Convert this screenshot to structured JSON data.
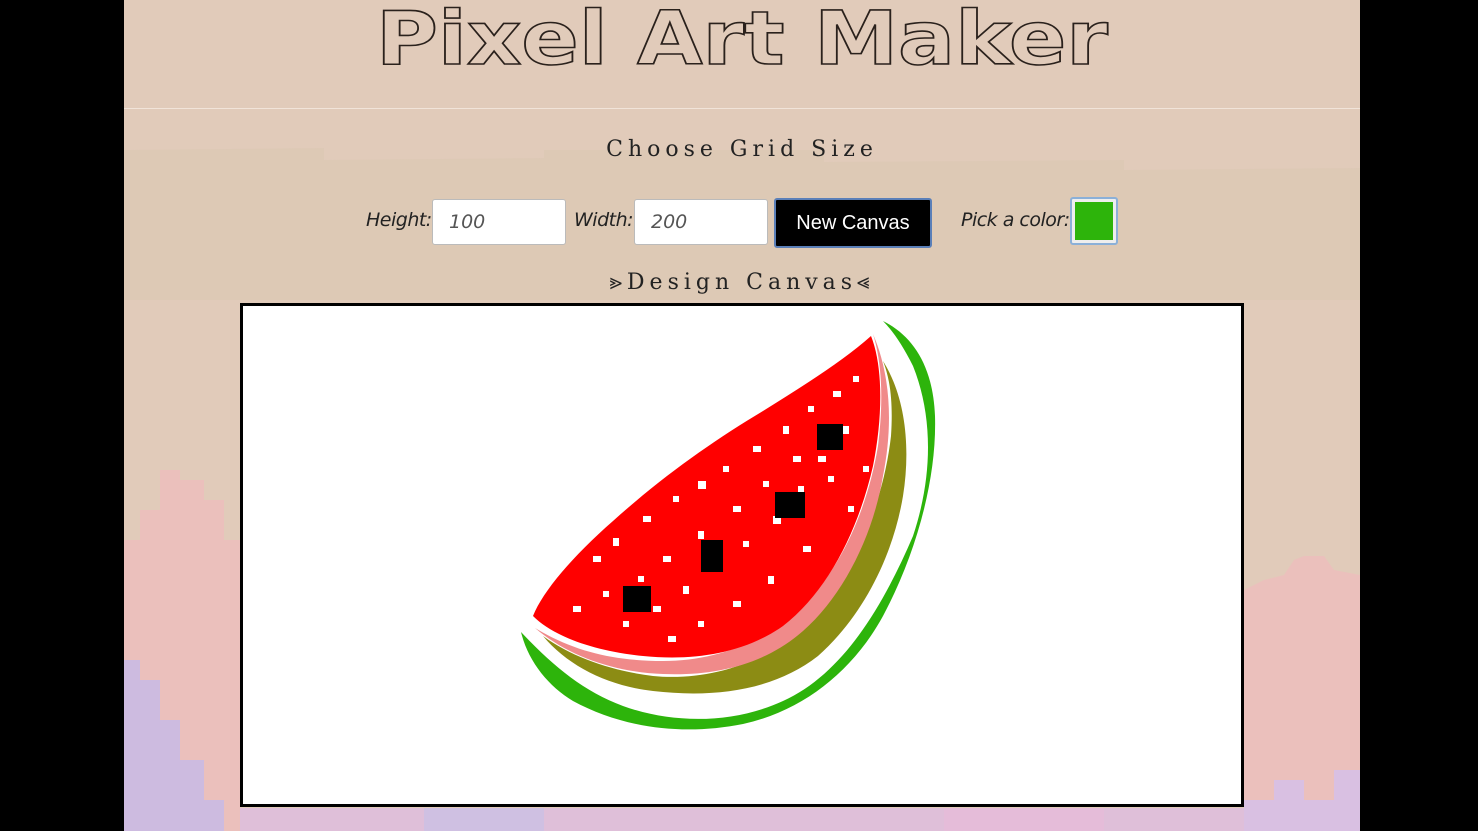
{
  "app": {
    "title": "Pixel Art Maker"
  },
  "grid_form": {
    "heading": "Choose Grid Size",
    "height_label": "Height:",
    "height_value": "100",
    "width_label": "Width:",
    "width_value": "200",
    "submit_label": "New Canvas"
  },
  "color_picker": {
    "label": "Pick a color:",
    "value": "#2db40b"
  },
  "canvas": {
    "heading": "⪢Design Canvas⪡",
    "grid_rows": 100,
    "grid_cols": 200,
    "background": "#ffffff",
    "artwork": "watermelon slice",
    "colors": {
      "rind": "#2db40b",
      "rind_inner": "#8c8c14",
      "flesh_edge": "#f08a8a",
      "flesh": "#ff0000",
      "seeds": "#000000"
    }
  },
  "theme": {
    "page_bg": "#e1cbba",
    "pink": "#ebc0bc",
    "lavender": "#cdbbe0",
    "outer_bg": "#000000"
  }
}
